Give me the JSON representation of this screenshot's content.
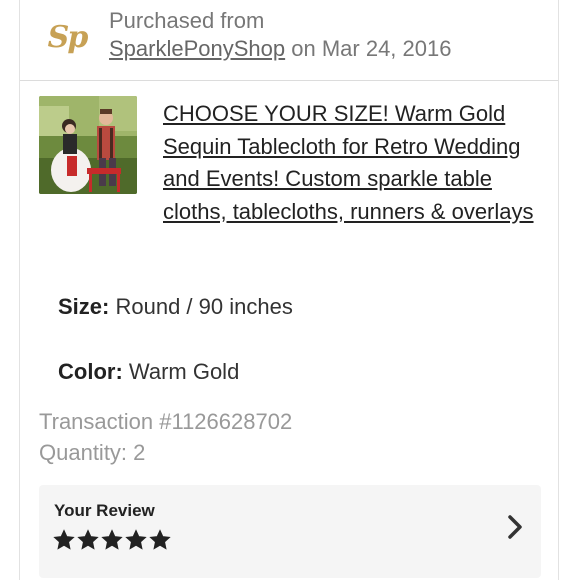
{
  "purchase": {
    "shop_logo_text": "Sp",
    "purchased_from_label": "Purchased from",
    "shop_name": "SparklePonyShop",
    "date_text": "on Mar 24, 2016"
  },
  "item": {
    "title": "CHOOSE YOUR SIZE! Warm Gold Sequin Tablecloth for Retro Wedding and Events! Custom sparkle table cloths, tablecloths, runners & overlays",
    "image_icon": "wedding-photo-thumbnail"
  },
  "variations": [
    {
      "label": "Size:",
      "value": "Round / 90 inches"
    },
    {
      "label": "Color:",
      "value": "Warm Gold"
    }
  ],
  "transaction": {
    "text": "Transaction #1126628702"
  },
  "quantity": {
    "text": "Quantity: 2"
  },
  "review": {
    "title": "Your Review",
    "rating": 5,
    "max_rating": 5
  },
  "colors": {
    "logo_gold": "#c7a155",
    "review_bg": "#f5f5f5",
    "muted_text": "#999999"
  }
}
